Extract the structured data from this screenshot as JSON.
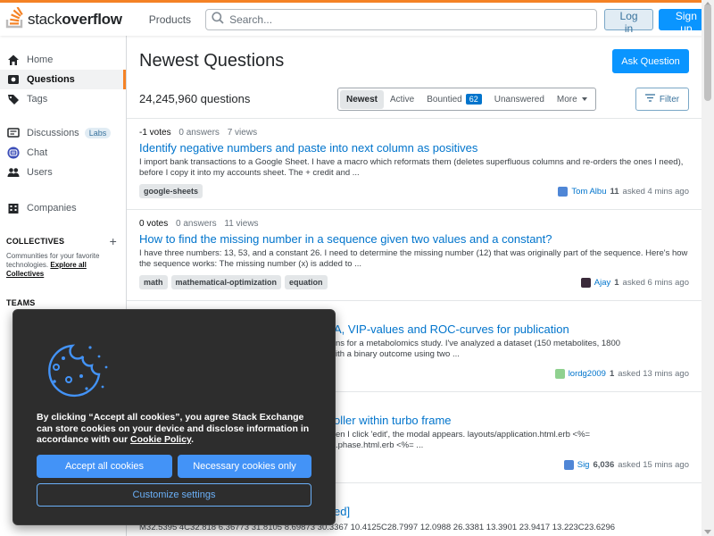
{
  "header": {
    "logo_regular": "stack",
    "logo_bold": "overflow",
    "products_label": "Products",
    "search_placeholder": "Search...",
    "login_label": "Log in",
    "signup_label": "Sign up",
    "accent_color": "#f48225"
  },
  "sidebar": {
    "home": "Home",
    "questions": "Questions",
    "tags": "Tags",
    "discussions": "Discussions",
    "labs_badge": "Labs",
    "chat": "Chat",
    "users": "Users",
    "companies": "Companies",
    "collectives_heading": "COLLECTIVES",
    "collectives_desc": "Communities for your favorite technologies.",
    "collectives_link": "Explore all Collectives",
    "teams_heading": "TEAMS"
  },
  "main": {
    "title": "Newest Questions",
    "ask_label": "Ask Question",
    "question_count": "24,245,960 questions",
    "filters": {
      "newest": "Newest",
      "active": "Active",
      "bountied": "Bountied",
      "bountied_count": "62",
      "unanswered": "Unanswered",
      "more": "More"
    },
    "filter_button": "Filter"
  },
  "questions": [
    {
      "votes": "-1 votes",
      "answers": "0 answers",
      "views": "7 views",
      "title": "Identify negative numbers and paste into next column as positives",
      "excerpt": "I import bank transactions to a Google Sheet. I have a macro which reformats them (deletes superfluous columns and re-orders the ones I need), before I copy it into my accounts sheet. The + credit and ...",
      "tags": [
        "google-sheets"
      ],
      "user": "Tom Albu",
      "rep": "11",
      "time": "asked 4 mins ago"
    },
    {
      "votes": "0 votes",
      "answers": "0 answers",
      "views": "11 views",
      "title": "How to find the missing number in a sequence given two values and a constant?",
      "excerpt": "I have three numbers: 13, 53, and a constant 26. I need to determine the missing number (12) that was originally part of the sequence. Here's how the sequence works: The missing number (x) is added to ...",
      "tags": [
        "math",
        "mathematical-optimization",
        "equation"
      ],
      "user": "Ajay",
      "rep": "1",
      "time": "asked 6 mins ago"
    },
    {
      "title_partial": "A, VIP-values and ROC-curves for publication",
      "excerpt_line1": "ns for a metabolomics study. I've analyzed a dataset (150 metabolites, 1800",
      "excerpt_line2": "ith a binary outcome using two ...",
      "user": "lordg2009",
      "rep": "1",
      "time": "asked 13 mins ago"
    },
    {
      "title_partial": "oller within turbo frame",
      "excerpt_line1": "en I click 'edit', the modal appears. layouts/application.html.erb <%=",
      "excerpt_line2": ".phase.html.erb <%= ...",
      "user": "Sig",
      "rep": "6,036",
      "time": "asked 15 mins ago"
    }
  ],
  "partial_bottom": {
    "title": "ed]",
    "text": "M32.5395 4C32.818 6.36773 31.8105 8.69873 30.3367 10.4125C28.7997 12.0988 26.3381 13.3901 23.9417 13.223C23.6296"
  },
  "cookie": {
    "text": "By clicking “Accept all cookies”, you agree Stack Exchange can store cookies on your device and disclose information in accordance with our",
    "link": "Cookie Policy",
    "period": ".",
    "accept": "Accept all cookies",
    "necessary": "Necessary cookies only",
    "customize": "Customize settings"
  }
}
